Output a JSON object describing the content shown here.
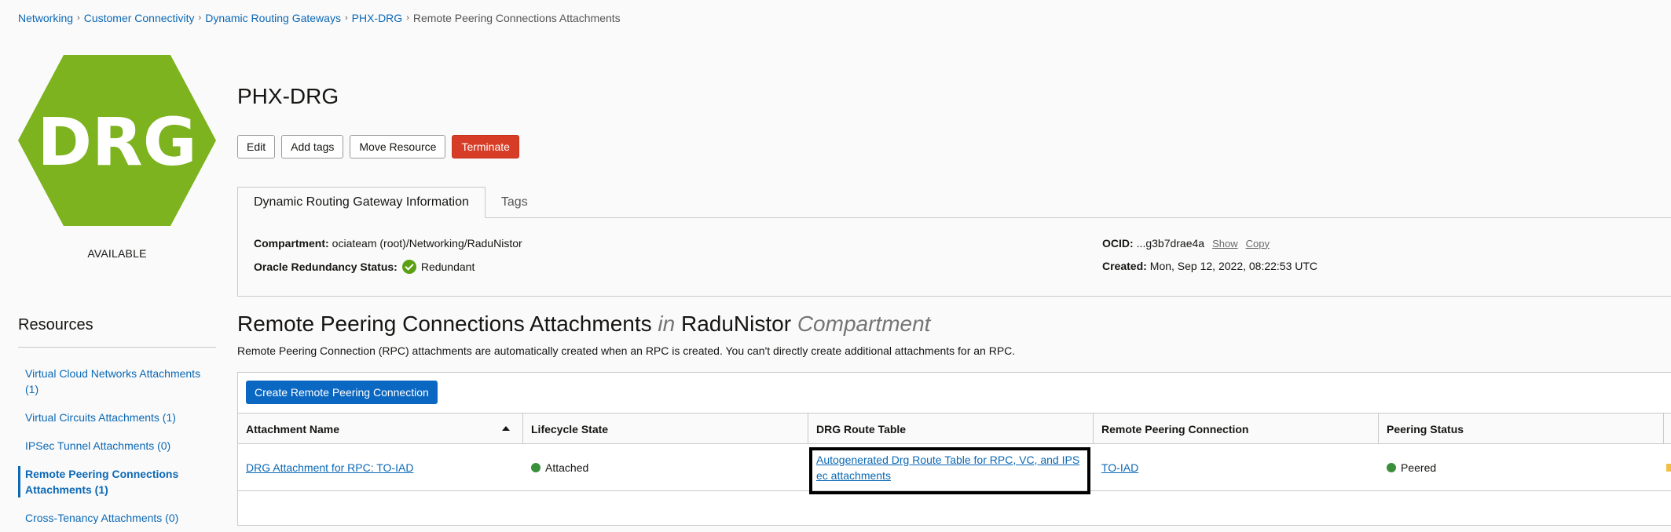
{
  "breadcrumb": {
    "items": [
      "Networking",
      "Customer Connectivity",
      "Dynamic Routing Gateways",
      "PHX-DRG"
    ],
    "current": "Remote Peering Connections Attachments"
  },
  "resource_icon": {
    "text": "DRG",
    "color": "#7cb31e",
    "status": "AVAILABLE"
  },
  "header": {
    "title": "PHX-DRG",
    "buttons": {
      "edit": "Edit",
      "add_tags": "Add tags",
      "move": "Move Resource",
      "terminate": "Terminate"
    }
  },
  "info": {
    "tabs": [
      "Dynamic Routing Gateway Information",
      "Tags"
    ],
    "compartment_label": "Compartment:",
    "compartment_value": "ociateam (root)/Networking/RaduNistor",
    "redundancy_label": "Oracle Redundancy Status:",
    "redundancy_value": "Redundant",
    "ocid_label": "OCID:",
    "ocid_value": "...g3b7drae4a",
    "show": "Show",
    "copy": "Copy",
    "created_label": "Created:",
    "created_value": "Mon, Sep 12, 2022, 08:22:53 UTC"
  },
  "resources": {
    "title": "Resources",
    "items": [
      {
        "label": "Virtual Cloud Networks Attachments (1)",
        "active": false
      },
      {
        "label": "Virtual Circuits Attachments (1)",
        "active": false
      },
      {
        "label": "IPSec Tunnel Attachments (0)",
        "active": false
      },
      {
        "label": "Remote Peering Connections Attachments (1)",
        "active": true
      },
      {
        "label": "Cross-Tenancy Attachments (0)",
        "active": false
      }
    ]
  },
  "section": {
    "title_main": "Remote Peering Connections Attachments",
    "title_in": "in",
    "title_compartment": "RaduNistor",
    "title_suffix": "Compartment",
    "description": "Remote Peering Connection (RPC) attachments are automatically created when an RPC is created. You can't directly create additional attachments for an RPC.",
    "create_button": "Create Remote Peering Connection"
  },
  "table": {
    "columns": [
      "Attachment Name",
      "Lifecycle State",
      "DRG Route Table",
      "Remote Peering Connection",
      "Peering Status"
    ],
    "rows": [
      {
        "attachment_name": "DRG Attachment for RPC: TO-IAD",
        "lifecycle_state": "Attached",
        "route_table": "Autogenerated Drg Route Table for RPC, VC, and IPSec attachments",
        "remote_peering_connection": "TO-IAD",
        "peering_status": "Peered"
      }
    ]
  },
  "colors": {
    "link": "#0b68b5",
    "danger": "#d73d26",
    "primary": "#0b68c2",
    "status_green": "#3a8f3a"
  }
}
